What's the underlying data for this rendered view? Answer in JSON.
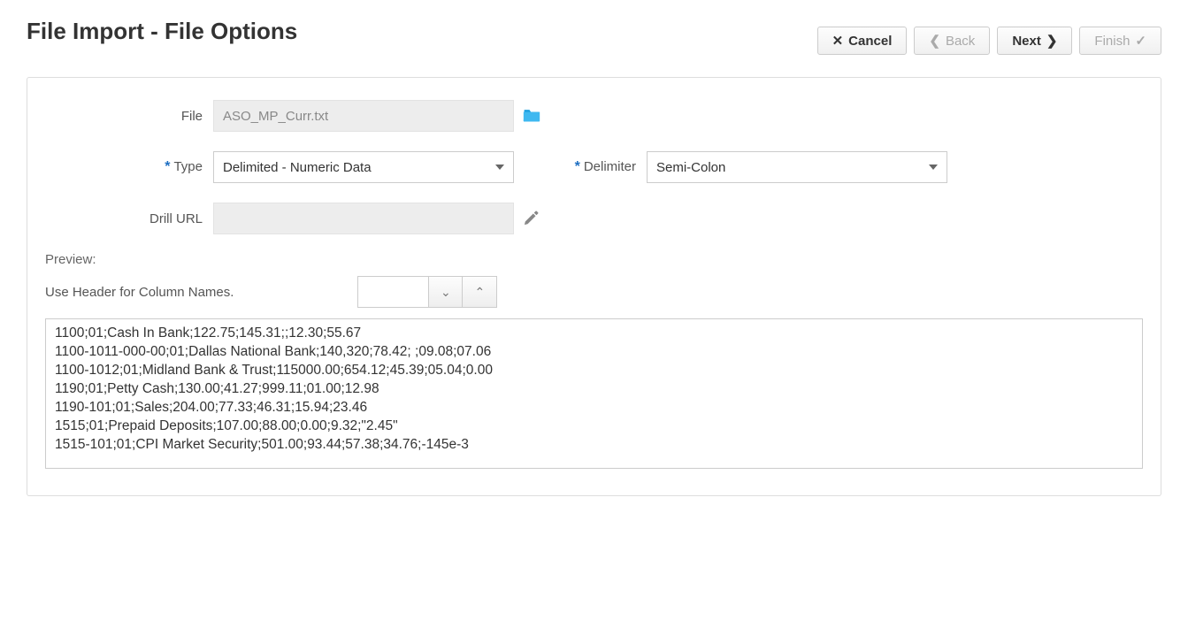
{
  "title": "File Import - File Options",
  "buttons": {
    "cancel": "Cancel",
    "back": "Back",
    "next": "Next",
    "finish": "Finish"
  },
  "form": {
    "file_label": "File",
    "file_value": "ASO_MP_Curr.txt",
    "type_label": "Type",
    "type_value": "Delimited - Numeric Data",
    "delimiter_label": "Delimiter",
    "delimiter_value": "Semi-Colon",
    "drill_url_label": "Drill URL",
    "drill_url_value": ""
  },
  "preview": {
    "label": "Preview:",
    "header_checkbox_label": "Use Header for Column Names.",
    "lines": [
      "1100;01;Cash In Bank;122.75;145.31;;12.30;55.67",
      "1100-1011-000-00;01;Dallas National Bank;140,320;78.42; ;09.08;07.06",
      "1100-1012;01;Midland Bank & Trust;115000.00;654.12;45.39;05.04;0.00",
      "1190;01;Petty Cash;130.00;41.27;999.11;01.00;12.98",
      "1190-101;01;Sales;204.00;77.33;46.31;15.94;23.46",
      "1515;01;Prepaid Deposits;107.00;88.00;0.00;9.32;\"2.45\"",
      "1515-101;01;CPI Market Security;501.00;93.44;57.38;34.76;-145e-3"
    ]
  }
}
